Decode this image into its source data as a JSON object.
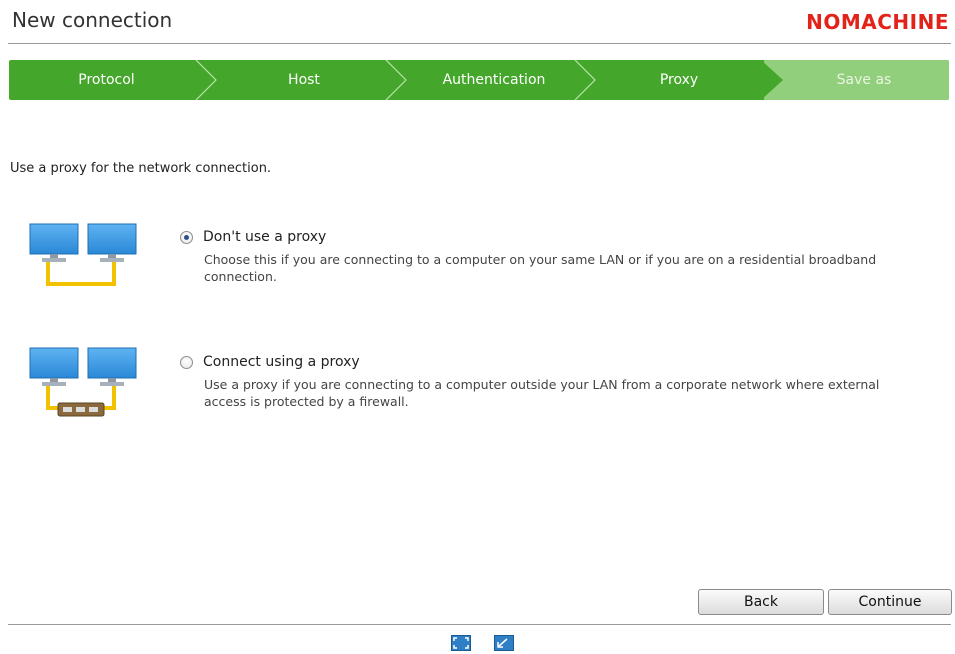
{
  "header": {
    "title": "New connection",
    "brand": "NOMACHINE"
  },
  "steps": [
    {
      "label": "Protocol",
      "state": "done"
    },
    {
      "label": "Host",
      "state": "done"
    },
    {
      "label": "Authentication",
      "state": "done"
    },
    {
      "label": "Proxy",
      "state": "current"
    },
    {
      "label": "Save as",
      "state": "future"
    }
  ],
  "main": {
    "intro": "Use a proxy for the network connection.",
    "options": [
      {
        "label": "Don't use a proxy",
        "description": "Choose this if you are connecting to a computer on your same LAN or if you are on a residential broadband connection.",
        "selected": true,
        "icon": "two-monitors-lan-icon"
      },
      {
        "label": "Connect using a proxy",
        "description": "Use a proxy if you are connecting to a computer outside your LAN from a corporate network where external access is protected by a firewall.",
        "selected": false,
        "icon": "two-monitors-proxy-icon"
      }
    ]
  },
  "buttons": {
    "back": "Back",
    "continue": "Continue"
  },
  "footer": {
    "icons": [
      "fullscreen-icon",
      "resize-icon"
    ]
  },
  "colors": {
    "step_active": "#44a72b",
    "step_future": "#92cf7c",
    "brand": "#e2231a"
  }
}
